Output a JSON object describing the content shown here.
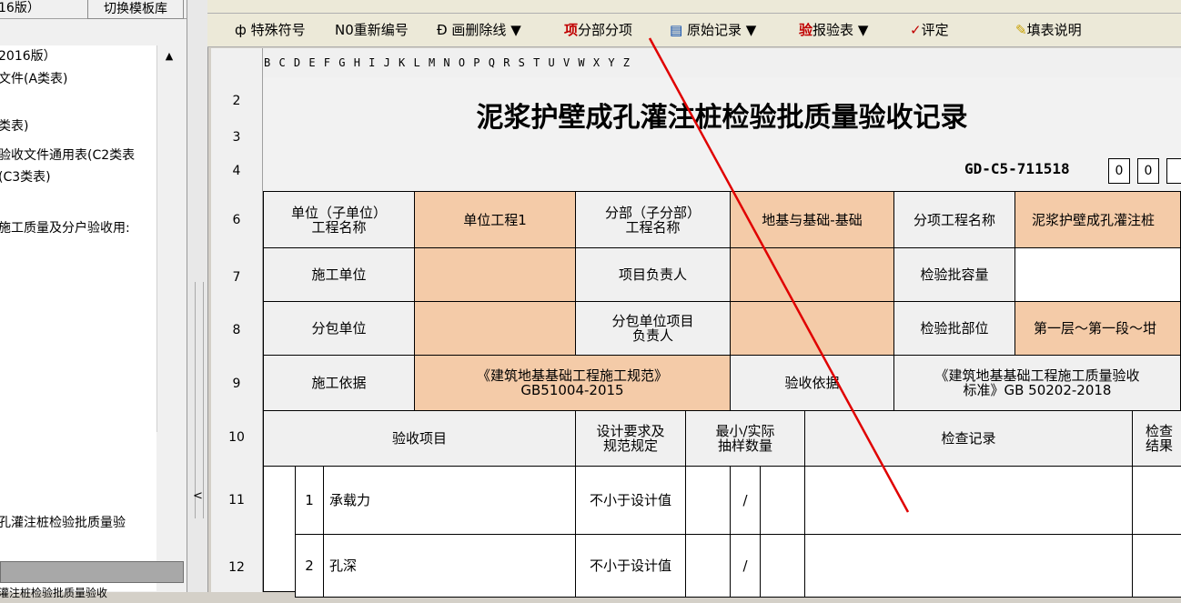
{
  "left_panel": {
    "title": "16版）",
    "switch_button": "切换模板库",
    "tree_items": [
      "2016版）",
      "文件(A类表)",
      "",
      "类表)",
      "验收文件通用表(C2类表",
      "(C3类表)",
      "",
      "",
      "施工质量及分户验收用:"
    ],
    "selected_item": "孔灌注桩检验批质量验",
    "bottom_item": "灌注桩检验批质量验收"
  },
  "toolbar": {
    "special_symbol": "特殊符号",
    "renumber": "N0重新编号",
    "strikethrough": "画删除线",
    "subdivision": "分部分项",
    "original_record": "原始记录",
    "report_form": "报验表",
    "evaluate": "评定",
    "fill_instructions": "填表说明"
  },
  "sheet": {
    "column_letters": "B C D E F G H I J K L M N O P Q R S T U V W X Y Z",
    "row_numbers": [
      "2",
      "3",
      "4",
      "6",
      "7",
      "8",
      "9",
      "10",
      "11",
      "12"
    ],
    "title": "泥浆护壁成孔灌注桩检验批质量验收记录",
    "code": "GD-C5-711518",
    "code_boxes": [
      "0",
      "0"
    ],
    "rows": {
      "r6": {
        "label": "单位（子单位）\n工程名称",
        "value": "单位工程1",
        "label2": "分部（子分部）\n工程名称",
        "value2": "地基与基础-基础",
        "label3": "分项工程名称",
        "value3": "泥浆护壁成孔灌注桩"
      },
      "r7": {
        "label": "施工单位",
        "value": "",
        "label2": "项目负责人",
        "value2": "",
        "label3": "检验批容量",
        "value3": ""
      },
      "r8": {
        "label": "分包单位",
        "value": "",
        "label2": "分包单位项目\n负责人",
        "value2": "",
        "label3": "检验批部位",
        "value3": "第一层～第一段～坩"
      },
      "r9": {
        "label": "施工依据",
        "value": "《建筑地基基础工程施工规范》\nGB51004-2015",
        "label2": "验收依据",
        "value2": "《建筑地基基础工程施工质量验收\n标准》GB 50202-2018"
      },
      "r10": {
        "item": "验收项目",
        "design": "设计要求及\n规范规定",
        "sample": "最小/实际\n抽样数量",
        "record": "检查记录",
        "result": "检查\n结果"
      },
      "r11": {
        "no": "1",
        "item": "承载力",
        "design": "不小于设计值",
        "sample": "/"
      },
      "r12": {
        "no": "2",
        "item": "孔深",
        "design": "不小于设计值",
        "sample": "/"
      }
    }
  },
  "colors": {
    "peach": "#f4cba8",
    "red_line": "#e00000"
  }
}
